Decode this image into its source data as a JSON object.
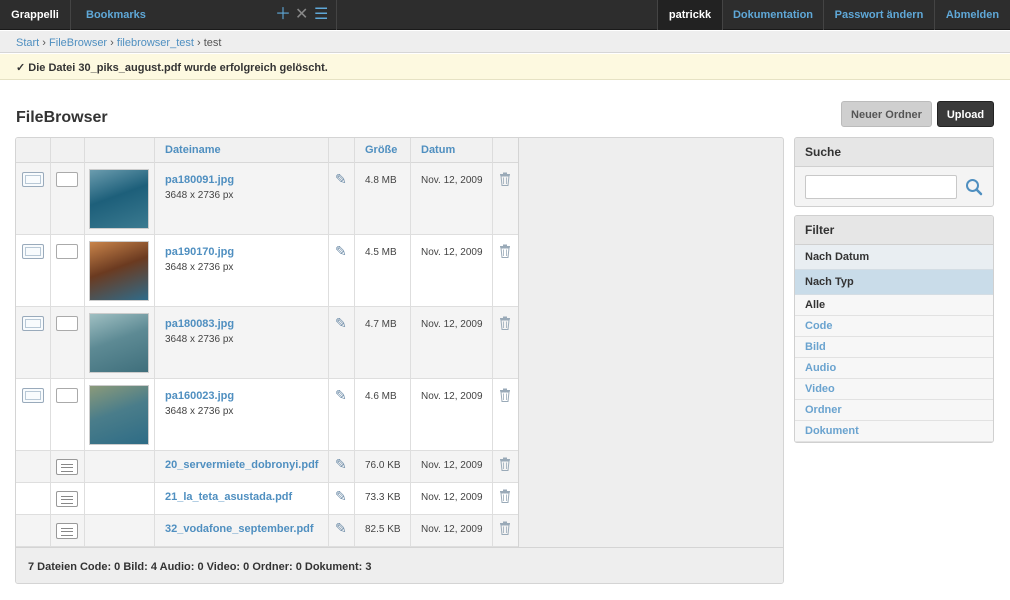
{
  "header": {
    "brand": "Grappelli",
    "bookmarks": "Bookmarks",
    "icons": [
      "plus-icon",
      "close-icon",
      "list-icon"
    ],
    "user": "patrickk",
    "links": [
      "Dokumentation",
      "Passwort ändern",
      "Abmelden"
    ]
  },
  "breadcrumb": {
    "items": [
      "Start",
      "FileBrowser",
      "filebrowser_test"
    ],
    "current": "test",
    "separator": "›"
  },
  "message": "✓  Die Datei 30_piks_august.pdf wurde erfolgreich gelöscht.",
  "page": {
    "title": "FileBrowser",
    "new_folder_label": "Neuer Ordner",
    "upload_label": "Upload"
  },
  "table": {
    "columns": [
      "Dateiname",
      "Größe",
      "Datum"
    ],
    "rows": [
      {
        "name": "pa180091.jpg",
        "dims": "3648 x 2736 px",
        "size": "4.8 MB",
        "date": "Nov. 12, 2009",
        "kind": "image",
        "thumb": [
          "#1d5f7a",
          "#6b9cae",
          "#3b7a90"
        ]
      },
      {
        "name": "pa190170.jpg",
        "dims": "3648 x 2736 px",
        "size": "4.5 MB",
        "date": "Nov. 12, 2009",
        "kind": "image",
        "thumb": [
          "#6b3a20",
          "#c9844a",
          "#2f6b8a"
        ]
      },
      {
        "name": "pa180083.jpg",
        "dims": "3648 x 2736 px",
        "size": "4.7 MB",
        "date": "Nov. 12, 2009",
        "kind": "image",
        "thumb": [
          "#5d8a94",
          "#9fbfc2",
          "#3f6f7c"
        ]
      },
      {
        "name": "pa160023.jpg",
        "dims": "3648 x 2736 px",
        "size": "4.6 MB",
        "date": "Nov. 12, 2009",
        "kind": "image",
        "thumb": [
          "#4a7d8a",
          "#8b9a7a",
          "#2e6c86"
        ]
      },
      {
        "name": "20_servermiete_dobronyi.pdf",
        "size": "76.0 KB",
        "date": "Nov. 12, 2009",
        "kind": "doc"
      },
      {
        "name": "21_la_teta_asustada.pdf",
        "size": "73.3 KB",
        "date": "Nov. 12, 2009",
        "kind": "doc"
      },
      {
        "name": "32_vodafone_september.pdf",
        "size": "82.5 KB",
        "date": "Nov. 12, 2009",
        "kind": "doc"
      }
    ],
    "summary": "7 Dateien  Code: 0  Bild: 4  Audio: 0  Video: 0  Ordner: 0  Dokument: 3"
  },
  "search": {
    "title": "Suche",
    "value": ""
  },
  "filter": {
    "title": "Filter",
    "by_date": "Nach Datum",
    "by_type": "Nach Typ",
    "items": [
      "Alle",
      "Code",
      "Bild",
      "Audio",
      "Video",
      "Ordner",
      "Dokument"
    ],
    "active": "Alle"
  },
  "colors": {
    "header_bg": "#2d2d2d",
    "link": "#4f8fc0",
    "message_bg": "#fdf9e0"
  }
}
